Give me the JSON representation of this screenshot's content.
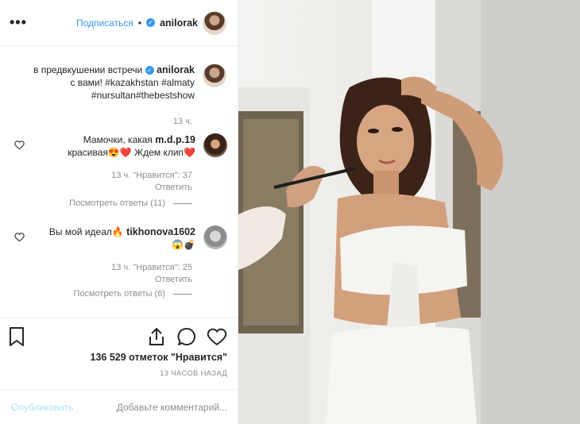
{
  "header": {
    "more_label": "•••",
    "follow_label": "Подписаться",
    "dot": "•",
    "username": "anilorak"
  },
  "caption": {
    "username": "anilorak",
    "lines": [
      "в предвкушении встречи",
      "с вами! #kazakhstan #almaty",
      "#nursultan#thebestshow"
    ],
    "time": "13 ч."
  },
  "comments": [
    {
      "username": "m.d.p.19",
      "lines": [
        "Мамочки, какая",
        "красивая😍❤️ Ждем клип❤️"
      ],
      "time_likes": "13 ч.   \"Нравится\": 37",
      "reply_label": "Ответить",
      "view_replies": "Посмотреть ответы (11)"
    },
    {
      "username": "tikhonova1602",
      "lines": [
        "Вы мой идеал🔥",
        "😱💣"
      ],
      "time_likes": "13 ч.   \"Нравится\": 25",
      "reply_label": "Ответить",
      "view_replies": "Посмотреть ответы (6)"
    }
  ],
  "actions": {
    "likes_text": "136 529 отметок \"Нравится\"",
    "ago": "13 ЧАСОВ НАЗАД"
  },
  "add_comment": {
    "placeholder": "Добавьте комментарий...",
    "publish_label": "Опубликовать"
  },
  "colors": {
    "accent": "#3897f0",
    "publish_disabled": "#b2dffc",
    "muted": "#8e8e8e",
    "text": "#262626"
  },
  "icons": [
    "more-icon",
    "verified-icon",
    "heart-icon",
    "comment-icon",
    "share-icon",
    "bookmark-icon"
  ]
}
